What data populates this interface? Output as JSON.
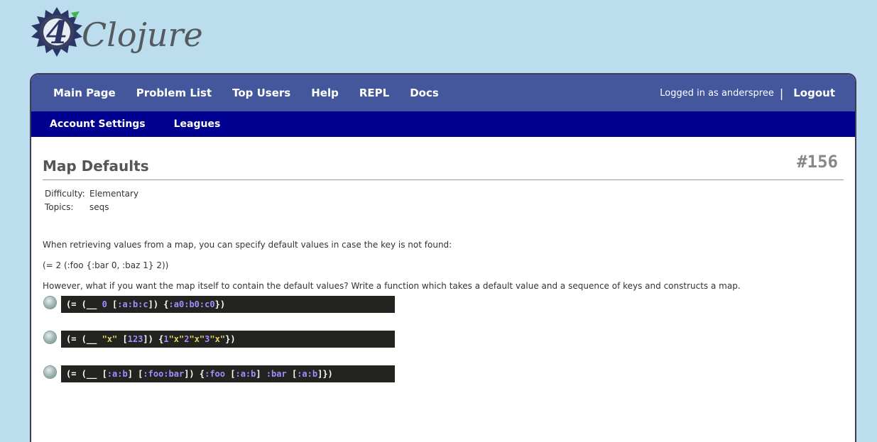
{
  "logo": {
    "number": "4",
    "wordmark": "Clojure"
  },
  "nav": {
    "main_page": "Main Page",
    "problem_list": "Problem List",
    "top_users": "Top Users",
    "help": "Help",
    "repl": "REPL",
    "docs": "Docs",
    "logged_in": "Logged in as anderspree",
    "separator": "|",
    "logout": "Logout"
  },
  "subnav": {
    "account_settings": "Account Settings",
    "leagues": "Leagues"
  },
  "problem": {
    "title": "Map Defaults",
    "number": "#156",
    "difficulty_label": "Difficulty:",
    "difficulty": "Elementary",
    "topics_label": "Topics:",
    "topics": "seqs",
    "description": [
      "When retrieving values from a map, you can specify default values in case the key is not found:",
      "(= 2 (:foo {:bar 0, :baz 1} 2))",
      "However, what if you want the map itself to contain the default values? Write a function which takes a default value and a sequence of keys and constructs a map."
    ]
  },
  "tests": [
    "(= (__ 0 [:a :b :c]) {:a 0 :b 0 :c 0})",
    "(= (__ \"x\" [1 2 3]) {1 \"x\" 2 \"x\" 3 \"x\"})",
    "(= (__ [:a :b] [:foo :bar]) {:foo [:a :b] :bar [:a :b]})"
  ],
  "colors": {
    "background": "#bbdded",
    "nav_top": "#44579c",
    "nav_sub": "#000090",
    "code_bg": "#23231f",
    "code_keyword": "#a58bff",
    "code_string": "#e8d36a"
  }
}
